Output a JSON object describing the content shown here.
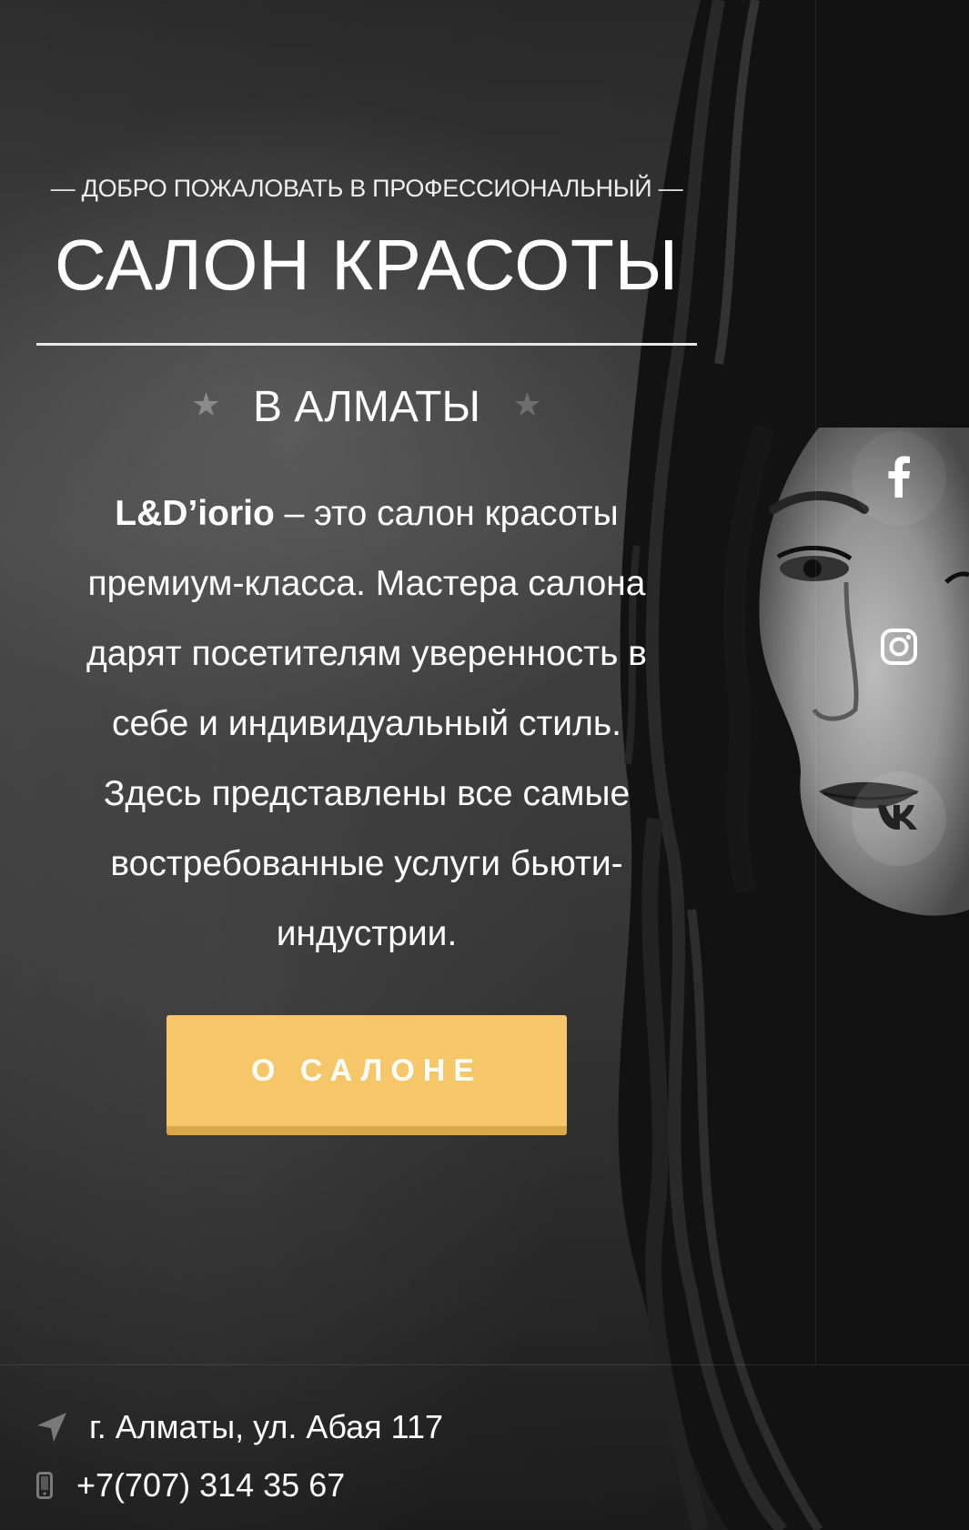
{
  "hero": {
    "welcome_dash_left": "—",
    "welcome_text": "ДОБРО ПОЖАЛОВАТЬ В ПРОФЕССИОНАЛЬНЫЙ",
    "welcome_dash_right": "—",
    "title": "САЛОН КРАСОТЫ",
    "city": "В АЛМАТЫ",
    "star_glyph": "★",
    "description": {
      "brand": "L&D’iorio",
      "line1_rest": " – это салон красоты",
      "line2": "премиум-класса. Мастера салона",
      "line3": "дарят посетителям уверенность в",
      "line4": "себе и индивидуальный стиль.",
      "line5": "Здесь представлены все самые",
      "line6": "востребованные услуги бьюти-",
      "line7": "индустрии."
    },
    "cta_label": "О САЛОНЕ"
  },
  "social": {
    "items": [
      {
        "name": "facebook",
        "icon": "facebook-icon"
      },
      {
        "name": "instagram",
        "icon": "instagram-icon"
      },
      {
        "name": "vkontakte",
        "icon": "vk-icon"
      }
    ]
  },
  "footer": {
    "address": "г. Алматы, ул. Абая 117",
    "address_icon": "location-arrow-icon",
    "phone": "+7(707) 314 35 67",
    "phone_icon": "mobile-phone-icon"
  },
  "colors": {
    "accent": "#f6c769",
    "accent_shadow": "#d9a84a",
    "text": "#ffffff",
    "background": "#3a3a3a"
  }
}
